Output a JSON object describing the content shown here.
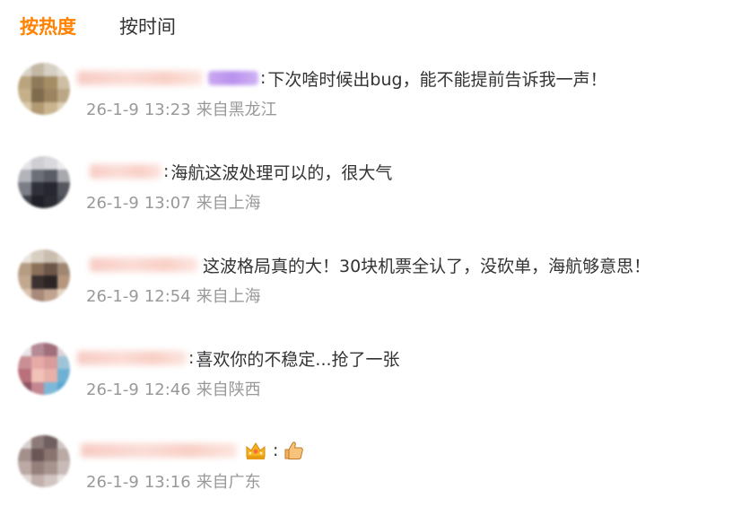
{
  "tabs": [
    {
      "label": "按热度",
      "active": true
    },
    {
      "label": "按时间",
      "active": false
    }
  ],
  "colors": {
    "accent": "#ff8200",
    "meta": "#999999",
    "text": "#333333"
  },
  "comments": [
    {
      "separator": ":",
      "text": "下次啥时候出bug，能不能提前告诉我一声！",
      "date": "26-1-9",
      "time": "13:23",
      "location": "来自黑龙江",
      "badge": "purple-badge"
    },
    {
      "separator": ":",
      "text": "海航这波处理可以的，很大气",
      "date": "26-1-9",
      "time": "13:07",
      "location": "来自上海"
    },
    {
      "separator": "",
      "text": "这波格局真的大！30块机票全认了，没砍单，海航够意思！",
      "date": "26-1-9",
      "time": "12:54",
      "location": "来自上海"
    },
    {
      "separator": ":",
      "text": "喜欢你的不稳定...抢了一张",
      "date": "26-1-9",
      "time": "12:46",
      "location": "来自陕西"
    },
    {
      "separator": ":",
      "text": "",
      "emoji": "thumbs-up-icon",
      "date": "26-1-9",
      "time": "13:16",
      "location": "来自广东",
      "badge": "crown-icon"
    }
  ]
}
